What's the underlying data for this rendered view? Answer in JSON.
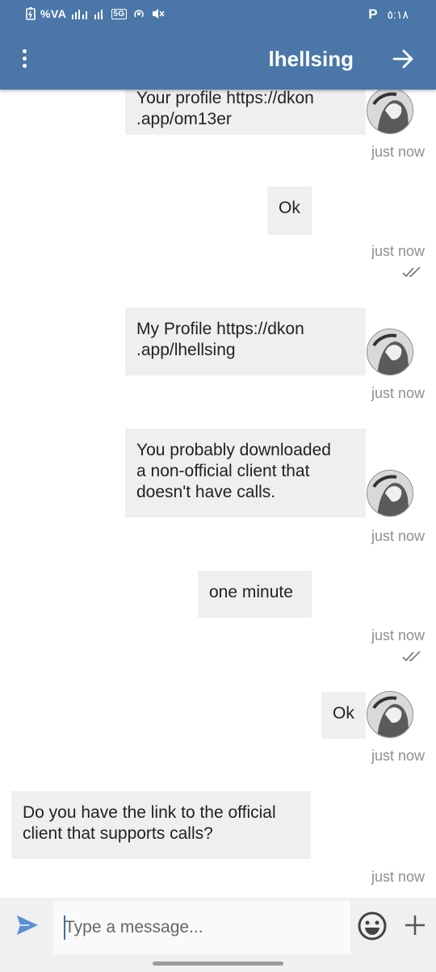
{
  "status_bar": {
    "left_text": "%VA",
    "time": "٥:١٨",
    "p_label": "P",
    "network_label": "5G"
  },
  "header": {
    "title": "lhellsing",
    "menu_icon": "more-vert-icon",
    "forward_icon": "arrow-forward-icon"
  },
  "messages": [
    {
      "text": "Your profile https://dkon\n.app/om13er",
      "time": "just now",
      "avatar": true,
      "ticks": false
    },
    {
      "text": "Ok",
      "time": "just now",
      "avatar": false,
      "ticks": true
    },
    {
      "text": "My Profile https://dkon\n.app/lhellsing",
      "time": "just now",
      "avatar": true,
      "ticks": false
    },
    {
      "text": "You probably downloaded\na non-official client that\ndoesn't have calls.",
      "time": "just now",
      "avatar": true,
      "ticks": false
    },
    {
      "text": "one minute",
      "time": "just now",
      "avatar": false,
      "ticks": true
    },
    {
      "text": "Ok",
      "time": "just now",
      "avatar": true,
      "ticks": false
    },
    {
      "text": "Do you have the link to the official\nclient that supports calls?",
      "time": "just now",
      "avatar": false,
      "ticks": false
    }
  ],
  "composer": {
    "placeholder": "Type a message...",
    "send_icon": "send-icon",
    "emoji_icon": "emoji-icon",
    "add_icon": "plus-icon"
  },
  "colors": {
    "header": "#4a77a8",
    "bubble": "#efefef",
    "timestamp": "#8f8f8f"
  }
}
